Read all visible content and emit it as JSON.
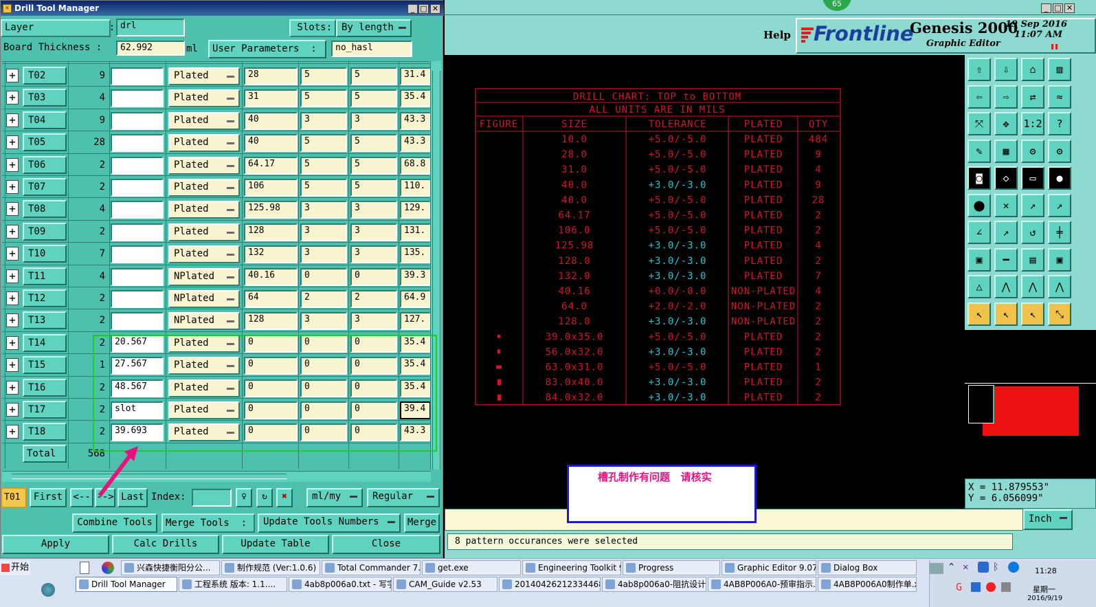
{
  "left_window": {
    "title": "Drill Tool Manager",
    "layer_label": "Layer             :",
    "layer_value": "drl",
    "slots_label": "Slots:",
    "slots_value": "By length",
    "thickness_label": "Board Thickness :",
    "thickness_value": "62.992",
    "thickness_unit": "ml",
    "user_params_label": "User Parameters  :",
    "user_params_value": "no_hasl",
    "rows": [
      {
        "tool": "T02",
        "count": "9",
        "white": "",
        "type": "Plated",
        "size": "28",
        "tp": "5",
        "tm": "5",
        "fin": "31.4"
      },
      {
        "tool": "T03",
        "count": "4",
        "white": "",
        "type": "Plated",
        "size": "31",
        "tp": "5",
        "tm": "5",
        "fin": "35.4"
      },
      {
        "tool": "T04",
        "count": "9",
        "white": "",
        "type": "Plated",
        "size": "40",
        "tp": "3",
        "tm": "3",
        "fin": "43.3"
      },
      {
        "tool": "T05",
        "count": "28",
        "white": "",
        "type": "Plated",
        "size": "40",
        "tp": "5",
        "tm": "5",
        "fin": "43.3"
      },
      {
        "tool": "T06",
        "count": "2",
        "white": "",
        "type": "Plated",
        "size": "64.17",
        "tp": "5",
        "tm": "5",
        "fin": "68.8"
      },
      {
        "tool": "T07",
        "count": "2",
        "white": "",
        "type": "Plated",
        "size": "106",
        "tp": "5",
        "tm": "5",
        "fin": "110."
      },
      {
        "tool": "T08",
        "count": "4",
        "white": "",
        "type": "Plated",
        "size": "125.98",
        "tp": "3",
        "tm": "3",
        "fin": "129."
      },
      {
        "tool": "T09",
        "count": "2",
        "white": "",
        "type": "Plated",
        "size": "128",
        "tp": "3",
        "tm": "3",
        "fin": "131."
      },
      {
        "tool": "T10",
        "count": "7",
        "white": "",
        "type": "Plated",
        "size": "132",
        "tp": "3",
        "tm": "3",
        "fin": "135."
      },
      {
        "tool": "T11",
        "count": "4",
        "white": "",
        "type": "NPlated",
        "size": "40.16",
        "tp": "0",
        "tm": "0",
        "fin": "39.3"
      },
      {
        "tool": "T12",
        "count": "2",
        "white": "",
        "type": "NPlated",
        "size": "64",
        "tp": "2",
        "tm": "2",
        "fin": "64.9"
      },
      {
        "tool": "T13",
        "count": "2",
        "white": "",
        "type": "NPlated",
        "size": "128",
        "tp": "3",
        "tm": "3",
        "fin": "127."
      },
      {
        "tool": "T14",
        "count": "2",
        "white": "20.567",
        "type": "Plated",
        "size": "0",
        "tp": "0",
        "tm": "0",
        "fin": "35.4"
      },
      {
        "tool": "T15",
        "count": "1",
        "white": "27.567",
        "type": "Plated",
        "size": "0",
        "tp": "0",
        "tm": "0",
        "fin": "35.4"
      },
      {
        "tool": "T16",
        "count": "2",
        "white": "48.567",
        "type": "Plated",
        "size": "0",
        "tp": "0",
        "tm": "0",
        "fin": "35.4"
      },
      {
        "tool": "T17",
        "count": "2",
        "white": "slot",
        "type": "Plated",
        "size": "0",
        "tp": "0",
        "tm": "0",
        "fin": "39.4"
      },
      {
        "tool": "T18",
        "count": "2",
        "white": "39.693",
        "type": "Plated",
        "size": "0",
        "tp": "0",
        "tm": "0",
        "fin": "43.3"
      }
    ],
    "total_label": "Total",
    "total_value": "568",
    "current_tool": "T01",
    "first": "First",
    "prev": "<--",
    "next": "-->",
    "last": "Last",
    "index_label": "Index:",
    "units_dd": "ml/my",
    "mode_dd": "Regular",
    "combine": "Combine Tools",
    "merge_label": "Merge Tools  :",
    "update_numbers": "Update Tools Numbers",
    "merge": "Merge",
    "apply": "Apply",
    "calc": "Calc Drills",
    "update_table": "Update Table",
    "close": "Close"
  },
  "editor": {
    "badge": "65",
    "help": "Help",
    "brand": "Frontline",
    "product": "Genesis 2000",
    "subtitle": "Graphic Editor",
    "date": "19 Sep 2016",
    "time": "11:07 AM",
    "x_readout": "X  =  11.879553\"",
    "y_readout": "Y  =  6.056099\"",
    "unit": "Inch",
    "status": "8 pattern occurances were selected",
    "note": "槽孔制作有问题   请核实"
  },
  "chart": {
    "title1": "DRILL CHART: TOP to BOTTOM",
    "title2": "ALL UNITS ARE IN MILS",
    "headers": [
      "FIGURE",
      "SIZE",
      "TOLERANCE",
      "PLATED",
      "QTY"
    ],
    "rows": [
      {
        "fig": "",
        "size": "10.0",
        "tol": "+5.0/-5.0",
        "pl": "PLATED",
        "qty": "484",
        "cyan": false
      },
      {
        "fig": "",
        "size": "28.0",
        "tol": "+5.0/-5.0",
        "pl": "PLATED",
        "qty": "9",
        "cyan": false
      },
      {
        "fig": "",
        "size": "31.0",
        "tol": "+5.0/-5.0",
        "pl": "PLATED",
        "qty": "4",
        "cyan": false
      },
      {
        "fig": "",
        "size": "40.0",
        "tol": "+3.0/-3.0",
        "pl": "PLATED",
        "qty": "9",
        "cyan": true
      },
      {
        "fig": "",
        "size": "40.0",
        "tol": "+5.0/-5.0",
        "pl": "PLATED",
        "qty": "28",
        "cyan": false
      },
      {
        "fig": "",
        "size": "64.17",
        "tol": "+5.0/-5.0",
        "pl": "PLATED",
        "qty": "2",
        "cyan": false
      },
      {
        "fig": "",
        "size": "106.0",
        "tol": "+5.0/-5.0",
        "pl": "PLATED",
        "qty": "2",
        "cyan": false
      },
      {
        "fig": "",
        "size": "125.98",
        "tol": "+3.0/-3.0",
        "pl": "PLATED",
        "qty": "4",
        "cyan": true
      },
      {
        "fig": "",
        "size": "128.0",
        "tol": "+3.0/-3.0",
        "pl": "PLATED",
        "qty": "2",
        "cyan": true
      },
      {
        "fig": "",
        "size": "132.0",
        "tol": "+3.0/-3.0",
        "pl": "PLATED",
        "qty": "7",
        "cyan": true
      },
      {
        "fig": "",
        "size": "40.16",
        "tol": "+0.0/-0.0",
        "pl": "NON-PLATED",
        "qty": "4",
        "cyan": false
      },
      {
        "fig": "",
        "size": "64.0",
        "tol": "+2.0/-2.0",
        "pl": "NON-PLATED",
        "qty": "2",
        "cyan": false
      },
      {
        "fig": "",
        "size": "128.0",
        "tol": "+3.0/-3.0",
        "pl": "NON-PLATED",
        "qty": "2",
        "cyan": true
      },
      {
        "fig": "dot",
        "size": "39.0x35.0",
        "tol": "+5.0/-5.0",
        "pl": "PLATED",
        "qty": "2",
        "cyan": false
      },
      {
        "fig": "sq",
        "size": "56.0x32.0",
        "tol": "+3.0/-3.0",
        "pl": "PLATED",
        "qty": "2",
        "cyan": true
      },
      {
        "fig": "wide",
        "size": "63.0x31.0",
        "tol": "+5.0/-5.0",
        "pl": "PLATED",
        "qty": "1",
        "cyan": false
      },
      {
        "fig": "tall",
        "size": "83.0x40.0",
        "tol": "+3.0/-3.0",
        "pl": "PLATED",
        "qty": "2",
        "cyan": true
      },
      {
        "fig": "tall",
        "size": "84.0x32.0",
        "tol": "+3.0/-3.0",
        "pl": "PLATED",
        "qty": "2",
        "cyan": true
      }
    ]
  },
  "taskbar": {
    "start": "开始",
    "row1": [
      "兴森快捷衡阳分公...",
      "制作规范 (Ver:1.0.6)",
      "Total Commander 7.0 ...",
      "get.exe",
      "Engineering Toolkit 9....",
      "Progress",
      "Graphic Editor 9.07b2...",
      "Dialog Box"
    ],
    "row2": [
      "Drill Tool Manager",
      "工程系统  版本: 1.1....",
      "4ab8p006a0.txt - 写字板",
      "CAM_Guide v2.53",
      "20140426212334468.rt...",
      "4ab8p006a0-阻抗设计...",
      "4AB8P006A0-预审指示...",
      "4AB8P006A0制作单.xl..."
    ],
    "clock": "11:28",
    "weekday": "星期一",
    "date": "2016/9/19"
  },
  "colors": {
    "chart_red": "#d2142a",
    "chart_cyan": "#19c8d8",
    "annotation_green": "#1ecc1e",
    "arrow_magenta": "#e8127c"
  }
}
